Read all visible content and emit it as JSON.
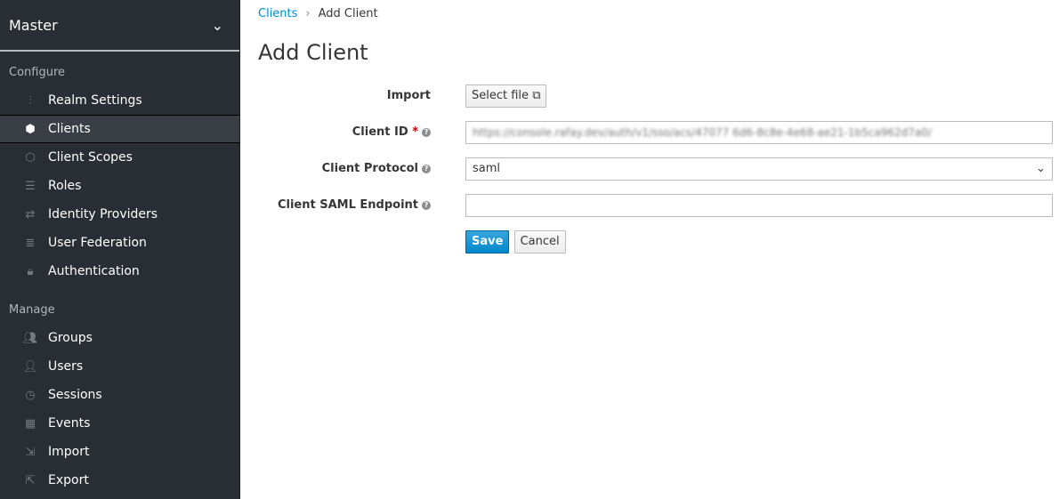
{
  "sidebar": {
    "realm": "Master",
    "configure_label": "Configure",
    "configure": [
      {
        "label": "Realm Settings",
        "icon": "sliders-icon"
      },
      {
        "label": "Clients",
        "icon": "cube-icon",
        "active": true
      },
      {
        "label": "Client Scopes",
        "icon": "cubes-icon"
      },
      {
        "label": "Roles",
        "icon": "list-icon"
      },
      {
        "label": "Identity Providers",
        "icon": "exchange-icon"
      },
      {
        "label": "User Federation",
        "icon": "database-icon"
      },
      {
        "label": "Authentication",
        "icon": "lock-icon"
      }
    ],
    "manage_label": "Manage",
    "manage": [
      {
        "label": "Groups",
        "icon": "users-icon"
      },
      {
        "label": "Users",
        "icon": "user-icon"
      },
      {
        "label": "Sessions",
        "icon": "clock-icon"
      },
      {
        "label": "Events",
        "icon": "calendar-icon"
      },
      {
        "label": "Import",
        "icon": "import-icon"
      },
      {
        "label": "Export",
        "icon": "export-icon"
      }
    ]
  },
  "breadcrumb": {
    "parent": "Clients",
    "current": "Add Client"
  },
  "title": "Add Client",
  "form": {
    "import_label": "Import",
    "select_file": "Select file",
    "client_id_label": "Client ID",
    "client_id_value": "https://console.rafay.dev/auth/v1/sso/acs/47077 6d6-8c8e-4e68-ae21-1b5ca962d7a0/",
    "protocol_label": "Client Protocol",
    "protocol_value": "saml",
    "endpoint_label": "Client SAML Endpoint",
    "endpoint_value": "",
    "save": "Save",
    "cancel": "Cancel"
  }
}
